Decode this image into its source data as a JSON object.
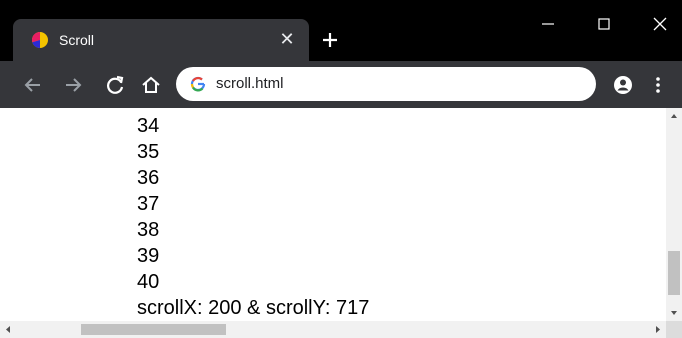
{
  "tab": {
    "title": "Scroll",
    "favicon": "pie-favicon-icon",
    "close_icon": "close-icon"
  },
  "newtab_icon": "plus-icon",
  "window_controls": [
    "minimize-icon",
    "maximize-icon",
    "close-icon"
  ],
  "toolbar": {
    "url": "scroll.html",
    "icons": [
      "back-arrow-icon",
      "forward-arrow-icon",
      "reload-icon",
      "home-icon",
      "google-g-icon",
      "profile-icon",
      "kebab-menu-icon"
    ]
  },
  "content": {
    "lines": [
      "34",
      "35",
      "36",
      "37",
      "38",
      "39",
      "40",
      "scrollX: 200 & scrollY: 717"
    ]
  },
  "colors": {
    "titlebar": "#000000",
    "toolbar": "#35363a",
    "tab": "#35363a",
    "omnibox": "#ffffff",
    "scrollbar_track": "#f1f1f1",
    "scrollbar_thumb": "#c1c1c1"
  }
}
